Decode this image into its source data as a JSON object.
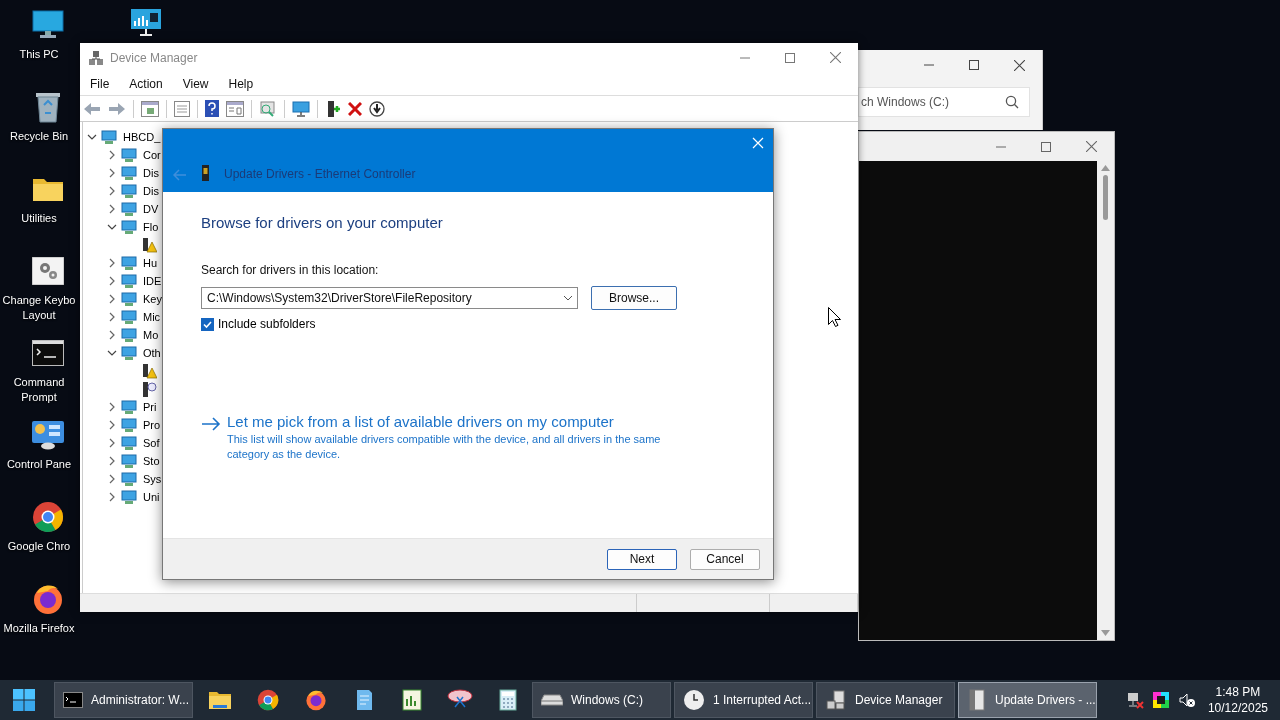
{
  "desktop_icons": [
    {
      "label": "This PC"
    },
    {
      "label": "Recycle Bin"
    },
    {
      "label": "Utilities"
    },
    {
      "label": "Change Keybo\nLayout"
    },
    {
      "label": "Command\nPrompt"
    },
    {
      "label": "Control Pane"
    },
    {
      "label": "Google Chro"
    },
    {
      "label": "Mozilla Firefox"
    }
  ],
  "explorer_window": {
    "search_placeholder": "ch Windows (C:)"
  },
  "device_manager": {
    "title": "Device Manager",
    "menu": [
      "File",
      "Action",
      "View",
      "Help"
    ],
    "tree": {
      "label": "HBCD_",
      "expanded": true,
      "children": [
        {
          "label": "Cor",
          "expanded": false
        },
        {
          "label": "Dis",
          "expanded": false
        },
        {
          "label": "Dis",
          "expanded": false
        },
        {
          "label": "DV",
          "expanded": false
        },
        {
          "label": "Flo",
          "expanded": true,
          "children": [
            {
              "kind": "warning"
            }
          ]
        },
        {
          "label": "Hu",
          "expanded": false
        },
        {
          "label": "IDE",
          "expanded": false
        },
        {
          "label": "Key",
          "expanded": false
        },
        {
          "label": "Mic",
          "expanded": false
        },
        {
          "label": "Mo",
          "expanded": false
        },
        {
          "label": "Oth",
          "expanded": true,
          "children": [
            {
              "kind": "warning"
            },
            {
              "kind": "unknown"
            }
          ]
        },
        {
          "label": "Pri",
          "expanded": false
        },
        {
          "label": "Pro",
          "expanded": false
        },
        {
          "label": "Sof",
          "expanded": false
        },
        {
          "label": "Sto",
          "expanded": false
        },
        {
          "label": "Sys",
          "expanded": false
        },
        {
          "label": "Uni",
          "expanded": false
        }
      ]
    }
  },
  "dialog": {
    "title": "Update Drivers - Ethernet Controller",
    "heading": "Browse for drivers on your computer",
    "location_label": "Search for drivers in this location:",
    "location_value": "C:\\Windows\\System32\\DriverStore\\FileRepository",
    "browse_button": "Browse...",
    "include_subfolders": {
      "label": "Include subfolders",
      "checked": true
    },
    "pick_link": "Let me pick from a list of available drivers on my computer",
    "pick_description": "This list will show available drivers compatible with the device, and all drivers in the same category as the device.",
    "buttons": [
      {
        "label": "Next",
        "default": true
      },
      {
        "label": "Cancel",
        "default": false
      }
    ]
  },
  "taskbar": {
    "items": [
      {
        "kind": "app",
        "label": "Administrator: W...",
        "selected": false
      },
      {
        "kind": "pinned",
        "selected": false
      },
      {
        "kind": "pinned",
        "selected": false
      },
      {
        "kind": "pinned",
        "selected": false
      },
      {
        "kind": "pinned",
        "selected": false
      },
      {
        "kind": "pinned",
        "selected": false
      },
      {
        "kind": "pinned",
        "selected": false
      },
      {
        "kind": "pinned",
        "selected": false
      },
      {
        "kind": "app",
        "label": "Windows (C:)",
        "selected": false
      },
      {
        "kind": "app",
        "label": "1 Interrupted Act...",
        "selected": false
      },
      {
        "kind": "app",
        "label": "Device Manager",
        "selected": false
      },
      {
        "kind": "app",
        "label": "Update Drivers - ...",
        "selected": true
      }
    ],
    "clock": {
      "time": "1:48 PM",
      "date": "10/12/2025"
    }
  }
}
